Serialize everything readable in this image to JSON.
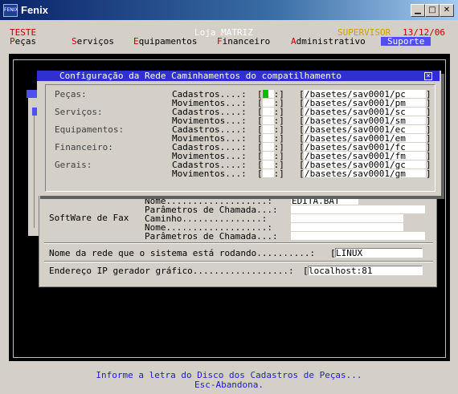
{
  "window": {
    "title": "Fenix",
    "icon_label": "FENIX"
  },
  "header": {
    "left": "TESTE",
    "center": "Loja MATRIZ",
    "user": "SUPERVISOR",
    "date": "13/12/06"
  },
  "menu": [
    {
      "hotkey": "P",
      "rest": "eças"
    },
    {
      "hotkey": "S",
      "rest": "erviços"
    },
    {
      "hotkey": "E",
      "rest": "quipamentos"
    },
    {
      "hotkey": "F",
      "rest": "inanceiro"
    },
    {
      "hotkey": "A",
      "rest": "dministrativo"
    },
    {
      "hotkey": "",
      "rest": "Suporte"
    }
  ],
  "dialog": {
    "title": "Configuração da Rede Caminhamentos do compatilhamento",
    "groups": [
      "Peças:",
      "Serviços:",
      "Equipamentos:",
      "Financeiro:",
      "Gerais:"
    ],
    "rows": [
      {
        "label": "Cadastros....:",
        "path": "/basetes/sav0001/pc"
      },
      {
        "label": "Movimentos...:",
        "path": "/basetes/sav0001/pm"
      },
      {
        "label": "Cadastros....:",
        "path": "/basetes/sav0001/sc"
      },
      {
        "label": "Movimentos...:",
        "path": "/basetes/sav0001/sm"
      },
      {
        "label": "Cadastros....:",
        "path": "/basetes/sav0001/ec"
      },
      {
        "label": "Movimentos...:",
        "path": "/basetes/sav0001/em"
      },
      {
        "label": "Cadastros....:",
        "path": "/basetes/sav0001/fc"
      },
      {
        "label": "Movimentos...:",
        "path": "/basetes/sav0001/fm"
      },
      {
        "label": "Cadastros....:",
        "path": "/basetes/sav0001/gc"
      },
      {
        "label": "Movimentos...:",
        "path": "/basetes/sav0001/gm"
      }
    ]
  },
  "background": {
    "software_fax_label": "SoftWare de Fax",
    "fields": [
      {
        "label": "Nome...................:",
        "value": "EDITA.BAT"
      },
      {
        "label": "Parâmetros de Chamada...:",
        "value": ""
      },
      {
        "label": "Caminho...............:",
        "value": ""
      },
      {
        "label": "Nome...................:",
        "value": ""
      },
      {
        "label": "Parâmetros de Chamada...:",
        "value": ""
      }
    ],
    "network_label": "Nome da rede que o sistema está rodando..........:",
    "network_value": "LINUX",
    "ip_label": "Endereço IP gerador gráfico..................:",
    "ip_value": "localhost:81"
  },
  "status": {
    "line1": "Informe a letra do Disco dos Cadastros de Peças...",
    "line2": "Esc-Abandona."
  },
  "colors": {
    "title_gradient_start": "#0a246a",
    "dialog_title": "#3030d0",
    "hotkey": "#c00000",
    "status_text": "#2020c0",
    "cursor": "#00c000"
  }
}
